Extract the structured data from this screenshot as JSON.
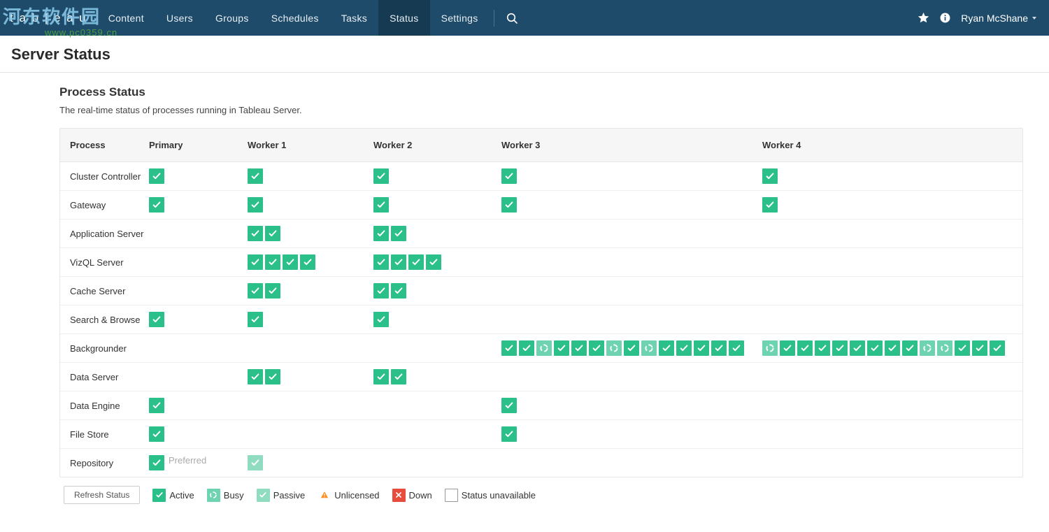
{
  "watermark": {
    "line1": "河东软件园",
    "line2": "www.pc0359.cn"
  },
  "topnav": {
    "logo_text": "t a b | e a u",
    "tabs": [
      {
        "label": "Content",
        "active": false
      },
      {
        "label": "Users",
        "active": false
      },
      {
        "label": "Groups",
        "active": false
      },
      {
        "label": "Schedules",
        "active": false
      },
      {
        "label": "Tasks",
        "active": false
      },
      {
        "label": "Status",
        "active": true
      },
      {
        "label": "Settings",
        "active": false
      }
    ],
    "user": "Ryan McShane"
  },
  "page_title": "Server Status",
  "section": {
    "title": "Process Status",
    "subtitle": "The real-time status of processes running in Tableau Server."
  },
  "columns": {
    "process": "Process",
    "primary": "Primary",
    "worker1": "Worker 1",
    "worker2": "Worker 2",
    "worker3": "Worker 3",
    "worker4": "Worker 4"
  },
  "rows": [
    {
      "name": "Cluster Controller",
      "primary": [
        "active"
      ],
      "w1": [
        "active"
      ],
      "w2": [
        "active"
      ],
      "w3": [
        "active"
      ],
      "w4": [
        "active"
      ]
    },
    {
      "name": "Gateway",
      "primary": [
        "active"
      ],
      "w1": [
        "active"
      ],
      "w2": [
        "active"
      ],
      "w3": [
        "active"
      ],
      "w4": [
        "active"
      ]
    },
    {
      "name": "Application Server",
      "primary": [],
      "w1": [
        "active",
        "active"
      ],
      "w2": [
        "active",
        "active"
      ],
      "w3": [],
      "w4": []
    },
    {
      "name": "VizQL Server",
      "primary": [],
      "w1": [
        "active",
        "active",
        "active",
        "active"
      ],
      "w2": [
        "active",
        "active",
        "active",
        "active"
      ],
      "w3": [],
      "w4": []
    },
    {
      "name": "Cache Server",
      "primary": [],
      "w1": [
        "active",
        "active"
      ],
      "w2": [
        "active",
        "active"
      ],
      "w3": [],
      "w4": []
    },
    {
      "name": "Search & Browse",
      "primary": [
        "active"
      ],
      "w1": [
        "active"
      ],
      "w2": [
        "active"
      ],
      "w3": [],
      "w4": []
    },
    {
      "name": "Backgrounder",
      "primary": [],
      "w1": [],
      "w2": [],
      "w3": [
        "active",
        "active",
        "busy",
        "active",
        "active",
        "active",
        "busy",
        "active",
        "busy",
        "active",
        "active",
        "active",
        "active",
        "active"
      ],
      "w4": [
        "busy",
        "active",
        "active",
        "active",
        "active",
        "active",
        "active",
        "active",
        "active",
        "busy",
        "busy",
        "active",
        "active",
        "active"
      ]
    },
    {
      "name": "Data Server",
      "primary": [],
      "w1": [
        "active",
        "active"
      ],
      "w2": [
        "active",
        "active"
      ],
      "w3": [],
      "w4": []
    },
    {
      "name": "Data Engine",
      "primary": [
        "active"
      ],
      "w1": [],
      "w2": [],
      "w3": [
        "active"
      ],
      "w4": []
    },
    {
      "name": "File Store",
      "primary": [
        "active"
      ],
      "w1": [],
      "w2": [],
      "w3": [
        "active"
      ],
      "w4": []
    },
    {
      "name": "Repository",
      "primary": [
        "active"
      ],
      "primary_extra": "Preferred",
      "w1": [
        "passive"
      ],
      "w2": [],
      "w3": [],
      "w4": []
    }
  ],
  "footer": {
    "refresh": "Refresh Status",
    "legend": [
      {
        "kind": "active",
        "label": "Active"
      },
      {
        "kind": "busy",
        "label": "Busy"
      },
      {
        "kind": "passive",
        "label": "Passive"
      },
      {
        "kind": "unlicensed",
        "label": "Unlicensed"
      },
      {
        "kind": "down",
        "label": "Down"
      },
      {
        "kind": "unavailable",
        "label": "Status unavailable"
      }
    ]
  }
}
